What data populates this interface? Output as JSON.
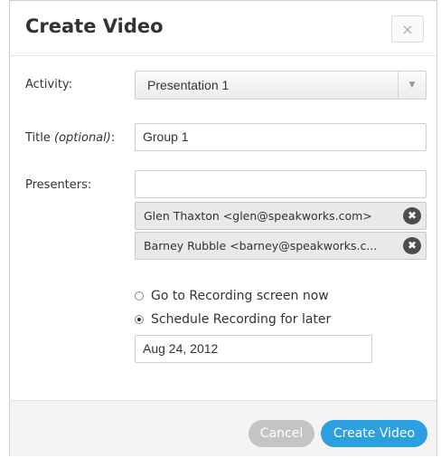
{
  "dialog": {
    "title": "Create Video",
    "close_label": "×"
  },
  "form": {
    "activity": {
      "label": "Activity:",
      "selected": "Presentation 1",
      "arrow_icon": "chevron-down-icon"
    },
    "title": {
      "label_main": "Title ",
      "label_optional": "(optional)",
      "label_colon": ":",
      "value": "Group 1"
    },
    "presenters": {
      "label": "Presenters:",
      "input_value": "",
      "chips": [
        {
          "text": "Glen Thaxton <glen@speakworks.com>",
          "remove": "✖"
        },
        {
          "text": "Barney Rubble <barney@speakworks.c...",
          "remove": "✖"
        }
      ]
    },
    "recording": {
      "options": [
        {
          "label": "Go to Recording screen now",
          "checked": false
        },
        {
          "label": "Schedule Recording for later",
          "checked": true
        }
      ],
      "date_value": "Aug 24, 2012"
    }
  },
  "footer": {
    "cancel_label": "Cancel",
    "create_label": "Create Video"
  },
  "colors": {
    "primary_button": "#2b9fe0",
    "cancel_button": "#c4c4c4",
    "chip_background": "#e9e9e9",
    "chip_remove": "#4d4d4d"
  }
}
